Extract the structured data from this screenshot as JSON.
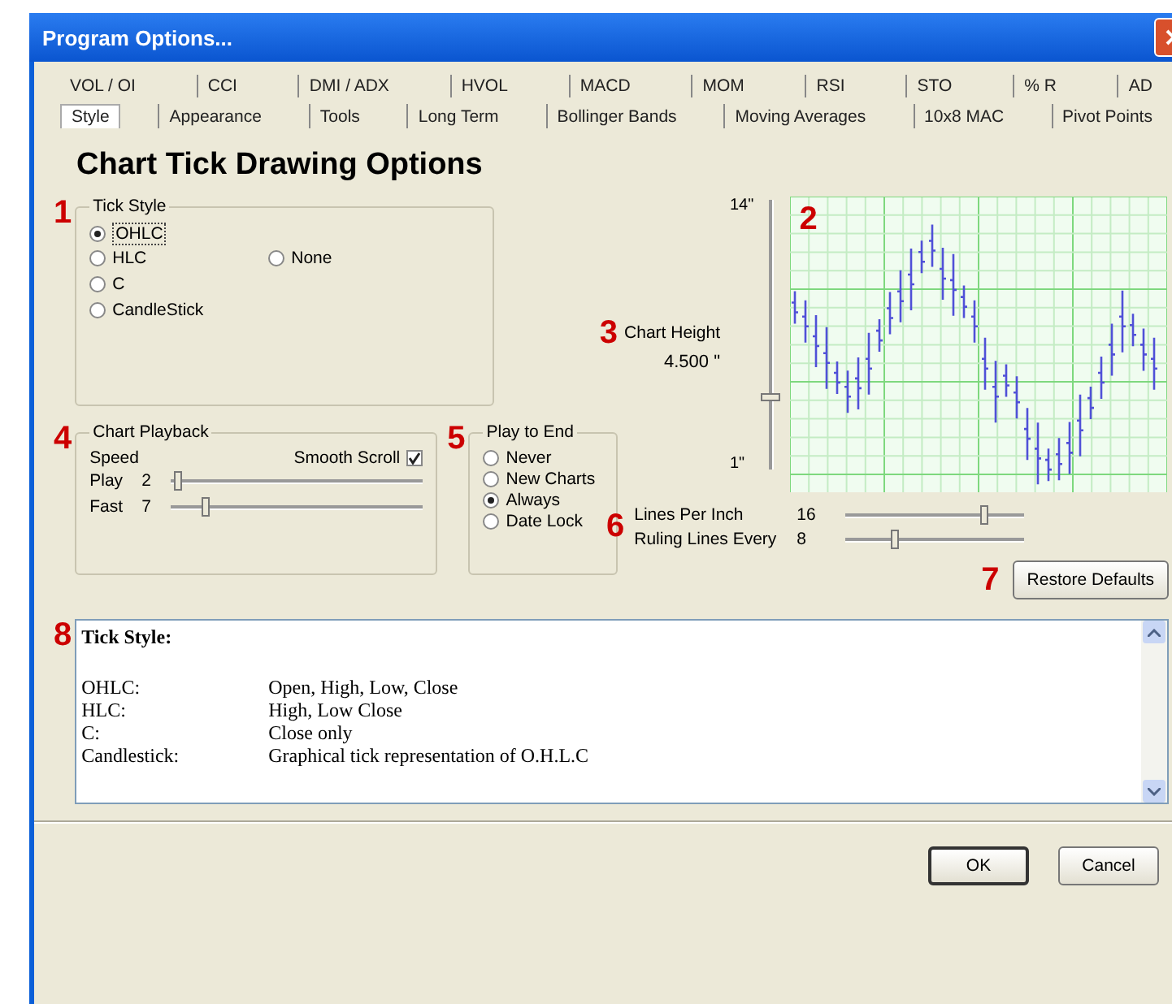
{
  "window": {
    "title": "Program Options..."
  },
  "tabs": [
    [
      {
        "label": "VOL / OI",
        "selected": false
      },
      {
        "label": "CCI",
        "selected": false
      },
      {
        "label": "DMI / ADX",
        "selected": false
      },
      {
        "label": "HVOL",
        "selected": false
      },
      {
        "label": "MACD",
        "selected": false
      },
      {
        "label": "MOM",
        "selected": false
      },
      {
        "label": "RSI",
        "selected": false
      },
      {
        "label": "STO",
        "selected": false
      },
      {
        "label": "% R",
        "selected": false
      },
      {
        "label": "AD",
        "selected": false
      }
    ],
    [
      {
        "label": "Style",
        "selected": true
      },
      {
        "label": "Appearance",
        "selected": false
      },
      {
        "label": "Tools",
        "selected": false
      },
      {
        "label": "Long Term",
        "selected": false
      },
      {
        "label": "Bollinger Bands",
        "selected": false
      },
      {
        "label": "Moving Averages",
        "selected": false
      },
      {
        "label": "10x8 MAC",
        "selected": false
      },
      {
        "label": "Pivot Points",
        "selected": false
      }
    ]
  ],
  "heading": "Chart Tick Drawing Options",
  "tick_style": {
    "marker": "1",
    "label": "Tick Style",
    "options": [
      {
        "label": "OHLC",
        "selected": true
      },
      {
        "label": "HLC",
        "selected": false
      },
      {
        "label": "C",
        "selected": false
      },
      {
        "label": "CandleStick",
        "selected": false
      },
      {
        "label": "None",
        "selected": false
      }
    ]
  },
  "preview": {
    "marker": "2"
  },
  "chart_height": {
    "marker": "3",
    "label": "Chart Height",
    "value": "4.500 \"",
    "max_label": "14\"",
    "min_label": "1\"",
    "level": 0.27
  },
  "playback": {
    "marker": "4",
    "label": "Chart Playback",
    "speed_label": "Speed",
    "smooth_scroll": {
      "label": "Smooth Scroll",
      "checked": true
    },
    "sliders": [
      {
        "label": "Play",
        "value": "2",
        "level": 0.03
      },
      {
        "label": "Fast",
        "value": "7",
        "level": 0.14
      }
    ]
  },
  "play_to_end": {
    "marker": "5",
    "label": "Play to End",
    "options": [
      {
        "label": "Never",
        "selected": false
      },
      {
        "label": "New Charts",
        "selected": false
      },
      {
        "label": "Always",
        "selected": true
      },
      {
        "label": "Date Lock",
        "selected": false
      }
    ]
  },
  "lines": {
    "marker": "6",
    "sliders": [
      {
        "label": "Lines Per Inch",
        "value": "16",
        "level": 0.78
      },
      {
        "label": "Ruling Lines Every",
        "value": "8",
        "level": 0.28
      }
    ]
  },
  "restore": {
    "marker": "7",
    "label": "Restore Defaults"
  },
  "help": {
    "marker": "8",
    "title": "Tick Style:",
    "rows": [
      {
        "term": "OHLC:",
        "desc": "Open, High, Low, Close"
      },
      {
        "term": "HLC:",
        "desc": "High, Low Close"
      },
      {
        "term": "C:",
        "desc": "Close only"
      },
      {
        "term": "Candlestick:",
        "desc": "Graphical tick representation of O.H.L.C"
      }
    ]
  },
  "buttons": [
    {
      "label": "OK",
      "default": true
    },
    {
      "label": "Cancel",
      "default": false
    }
  ]
}
